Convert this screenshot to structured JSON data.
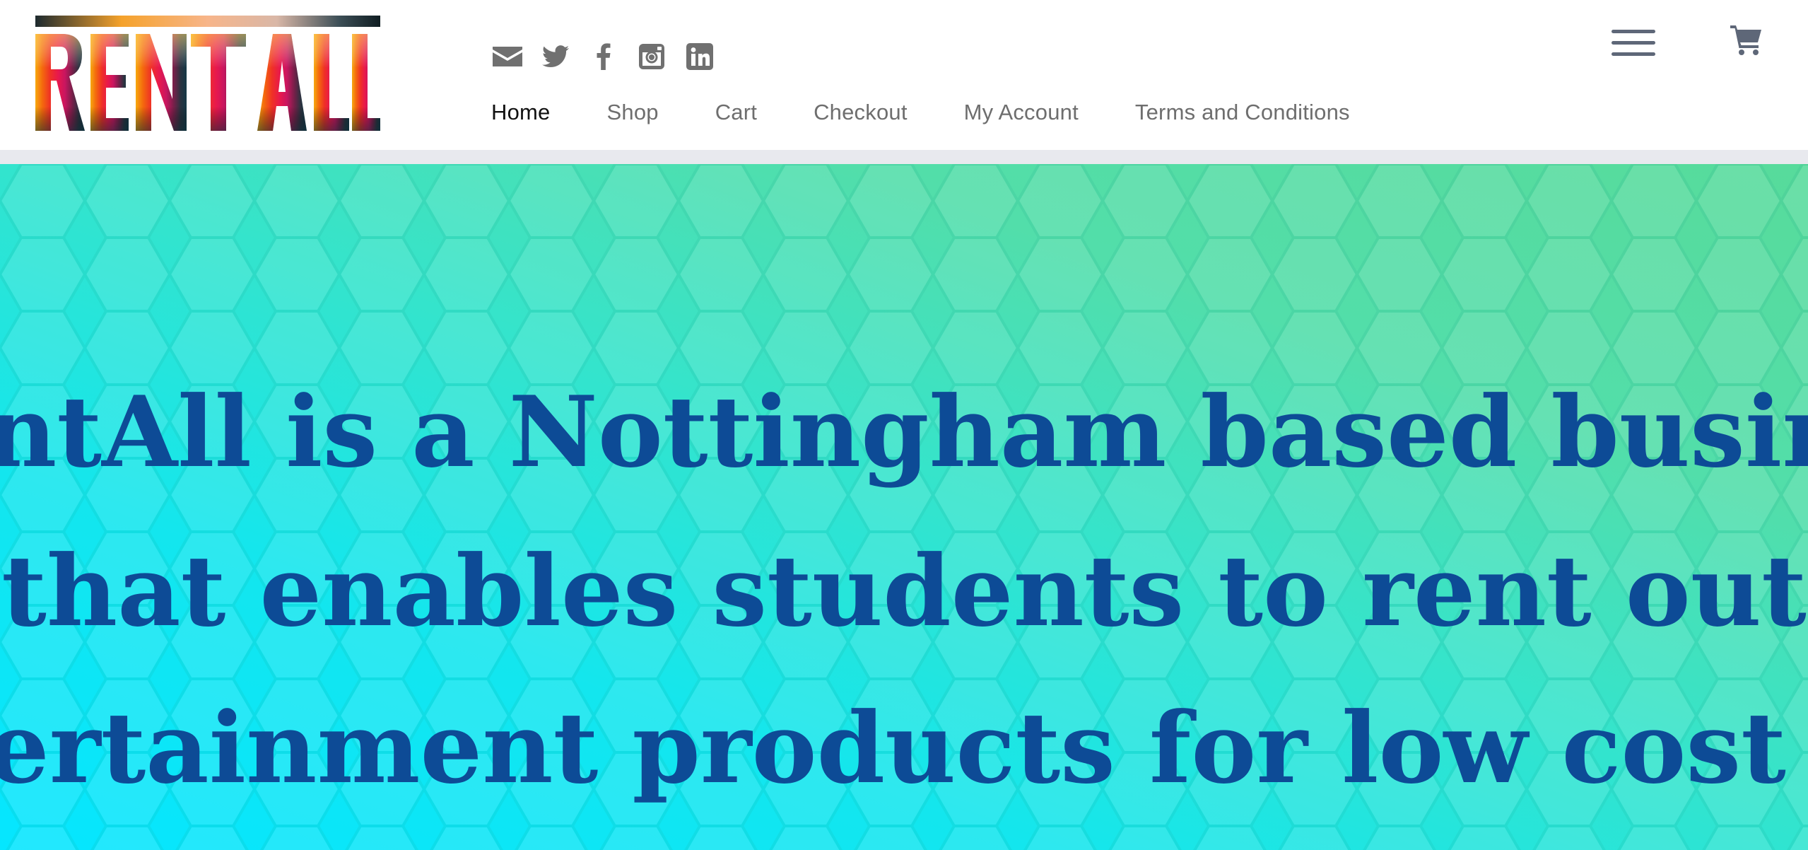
{
  "brand": {
    "logo_text": "RENTALL"
  },
  "social": [
    {
      "name": "email",
      "icon": "mail-icon"
    },
    {
      "name": "twitter",
      "icon": "twitter-icon"
    },
    {
      "name": "facebook",
      "icon": "facebook-icon"
    },
    {
      "name": "instagram",
      "icon": "instagram-icon"
    },
    {
      "name": "linkedin",
      "icon": "linkedin-icon"
    }
  ],
  "nav": {
    "items": [
      {
        "label": "Home",
        "active": true
      },
      {
        "label": "Shop",
        "active": false
      },
      {
        "label": "Cart",
        "active": false
      },
      {
        "label": "Checkout",
        "active": false
      },
      {
        "label": "My Account",
        "active": false
      },
      {
        "label": "Terms and Conditions",
        "active": false
      }
    ]
  },
  "header_actions": {
    "menu_icon": "hamburger-menu-icon",
    "cart_icon": "shopping-cart-icon"
  },
  "hero": {
    "lines": [
      "ntAll is a Nottingham based busine",
      "that enables students to rent out",
      "ertainment products for low cost a"
    ]
  },
  "colors": {
    "nav_text": "#6e6e6e",
    "nav_active": "#111111",
    "icon_gray": "#5e6778",
    "hero_text": "#0d4b96",
    "hero_top": "#57db9b",
    "hero_bottom": "#05e6ff",
    "header_rule": "#e8e9ee"
  }
}
